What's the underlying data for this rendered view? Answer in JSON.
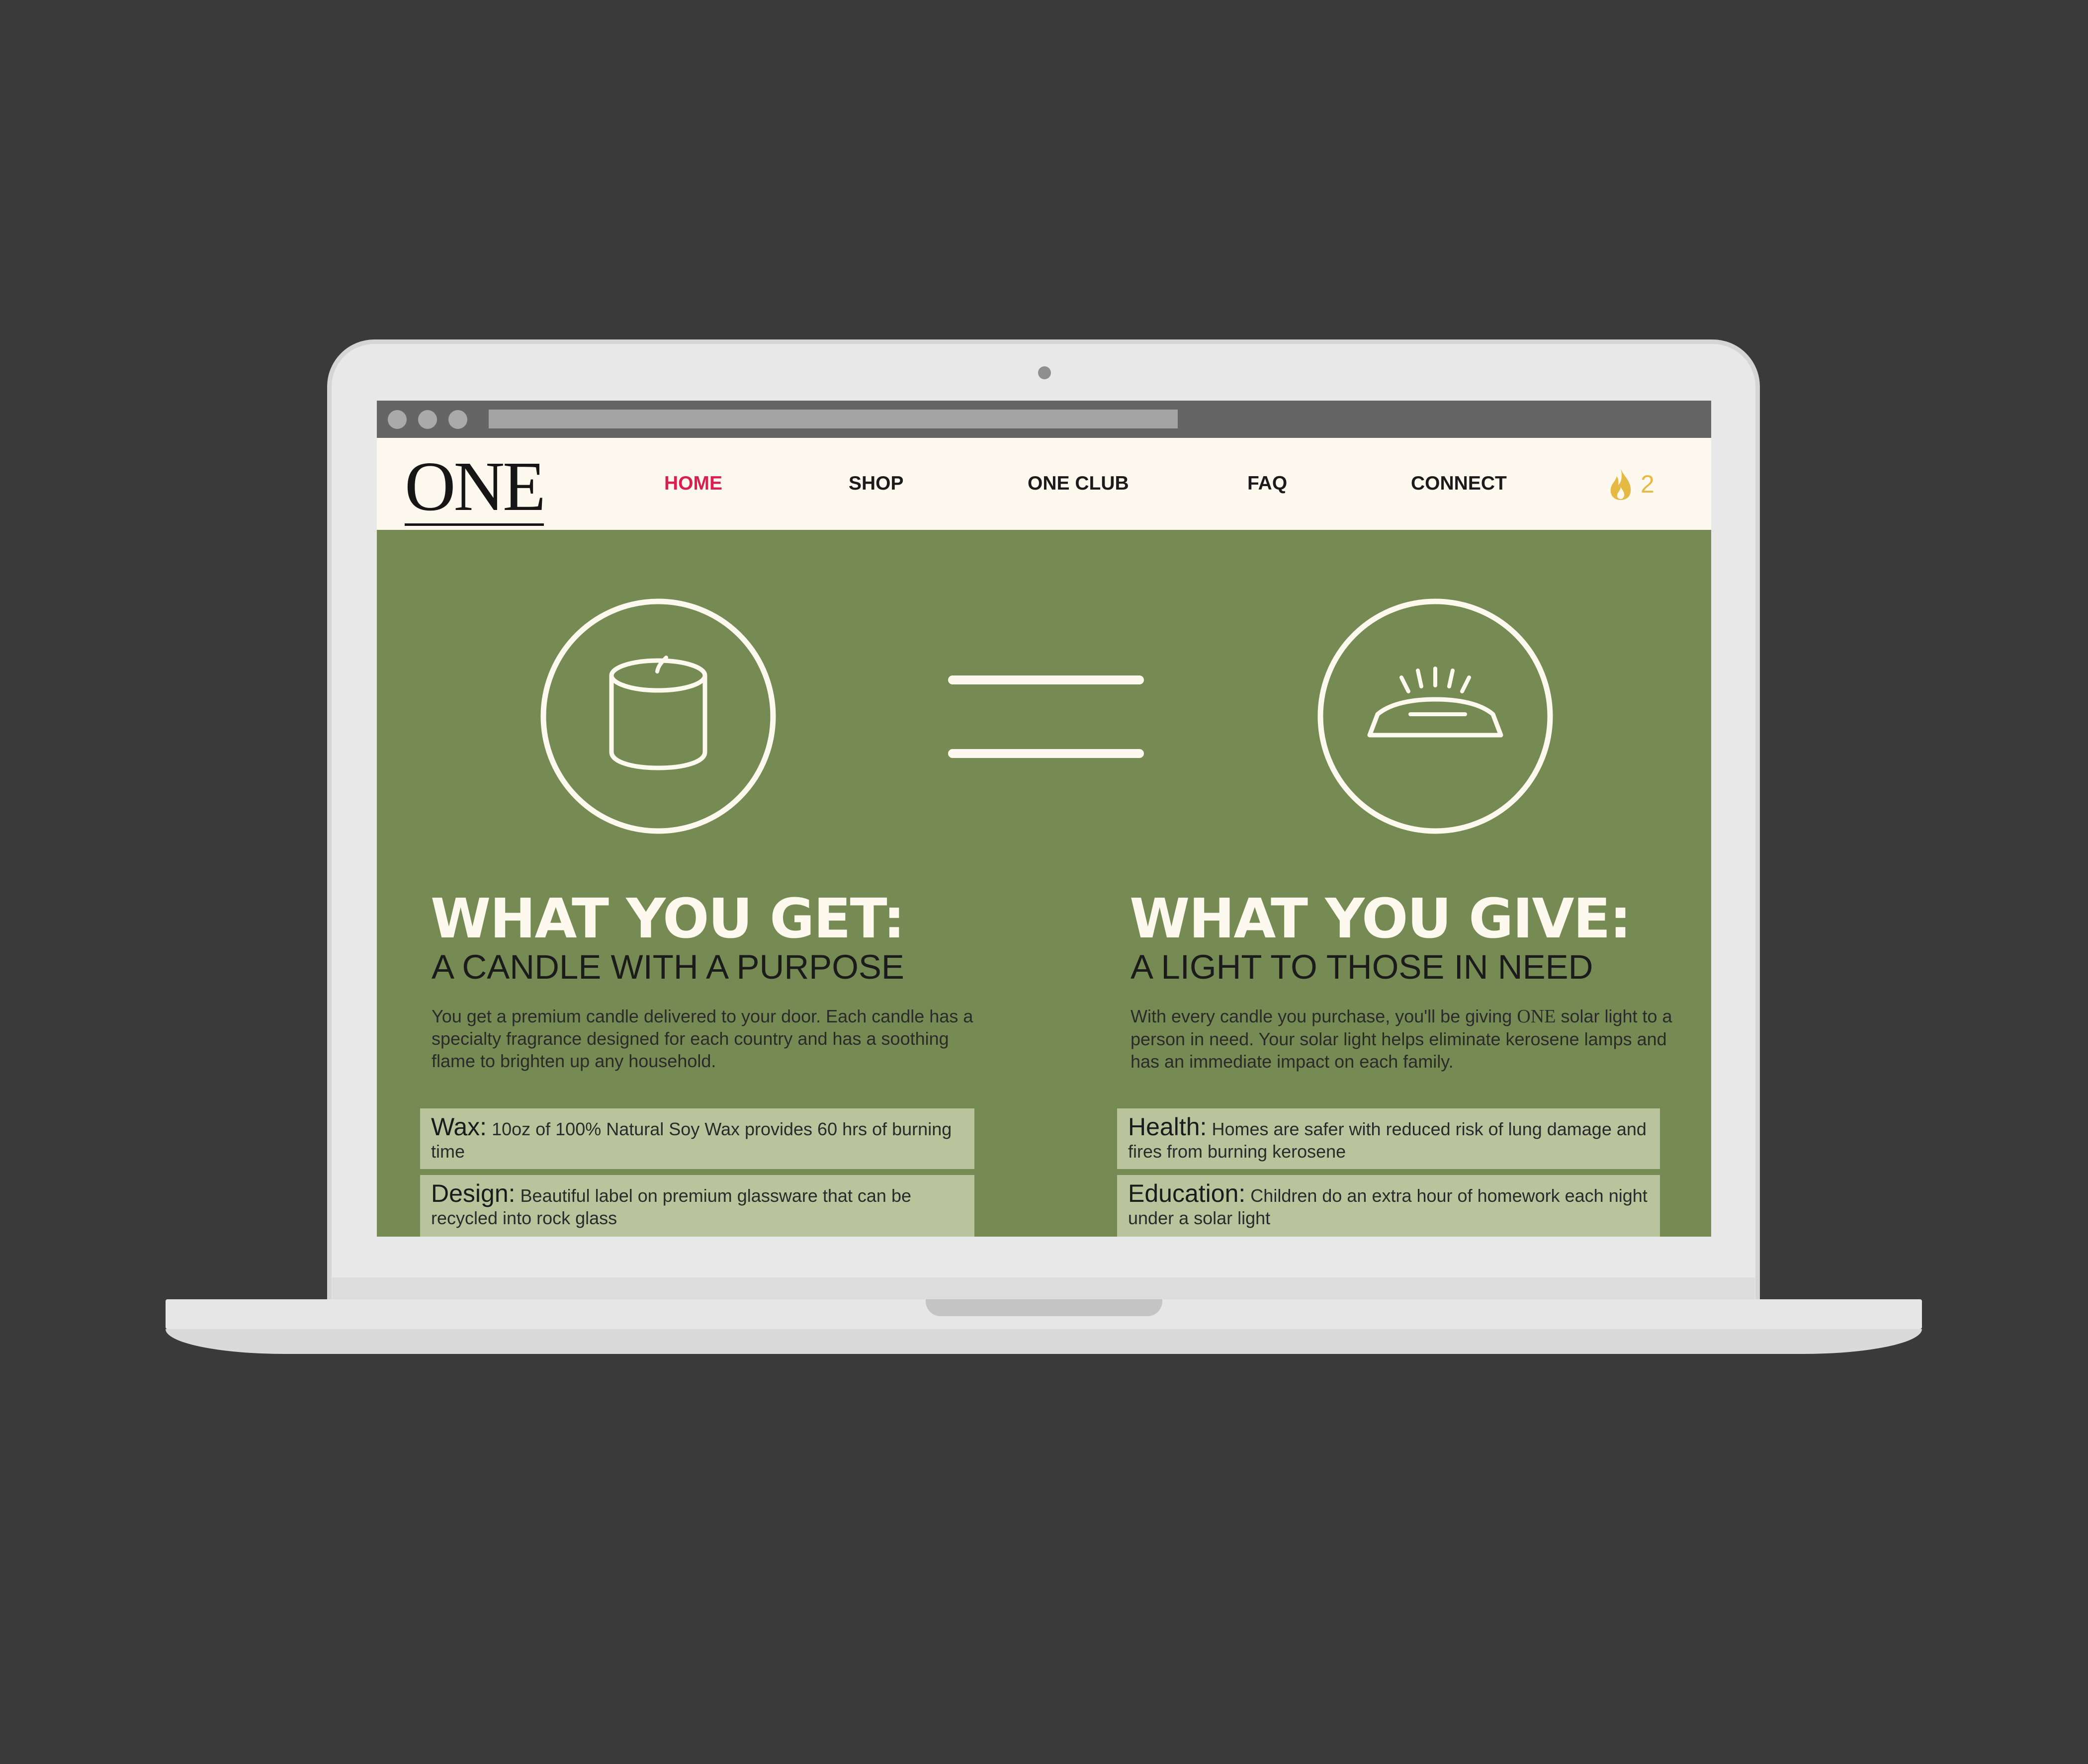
{
  "browser": {
    "window_dots": [
      "close",
      "minimize",
      "maximize"
    ]
  },
  "nav": {
    "logo": "ONE",
    "items": [
      {
        "label": "HOME",
        "active": true
      },
      {
        "label": "SHOP",
        "active": false
      },
      {
        "label": "ONE CLUB",
        "active": false
      },
      {
        "label": "FAQ",
        "active": false
      },
      {
        "label": "CONNECT",
        "active": false
      }
    ],
    "cart_icon": "flame-icon",
    "cart_count": "2"
  },
  "hero": {
    "left_icon": "candle-icon",
    "middle_icon": "equals-icon",
    "right_icon": "solar-light-icon"
  },
  "get": {
    "title": "WHAT YOU GET:",
    "subtitle": "A CANDLE WITH A PURPOSE",
    "description": "You get a premium candle delivered to your door. Each candle has a specialty fragrance designed for each country and has a soothing flame to brighten up any household.",
    "features": [
      {
        "key": "Wax:",
        "text": "10oz of 100% Natural Soy Wax provides 60 hrs of burning time"
      },
      {
        "key": "Design:",
        "text": "Beautiful label on premium glassware that can be recycled into rock glass"
      }
    ]
  },
  "give": {
    "title": "WHAT YOU GIVE:",
    "subtitle": "A LIGHT TO THOSE IN NEED",
    "description_before": "With every candle you purchase, you'll be giving",
    "description_brand": "ONE",
    "description_after": "solar light to a person in need. Your solar light helps eliminate kerosene lamps and has an immediate impact on each family.",
    "features": [
      {
        "key": "Health:",
        "text": "Homes are safer with reduced risk of lung damage and fires from burning kerosene"
      },
      {
        "key": "Education:",
        "text": "Children do an extra hour of homework each night under a solar light"
      }
    ]
  },
  "colors": {
    "background": "#3a3a3a",
    "page_green": "#768b53",
    "nav_bg": "#fdf9ee",
    "nav_active": "#d81f4f",
    "accent_gold": "#e5b944",
    "feature_bg": "#b9c49c",
    "cream": "#fdf9ee"
  }
}
